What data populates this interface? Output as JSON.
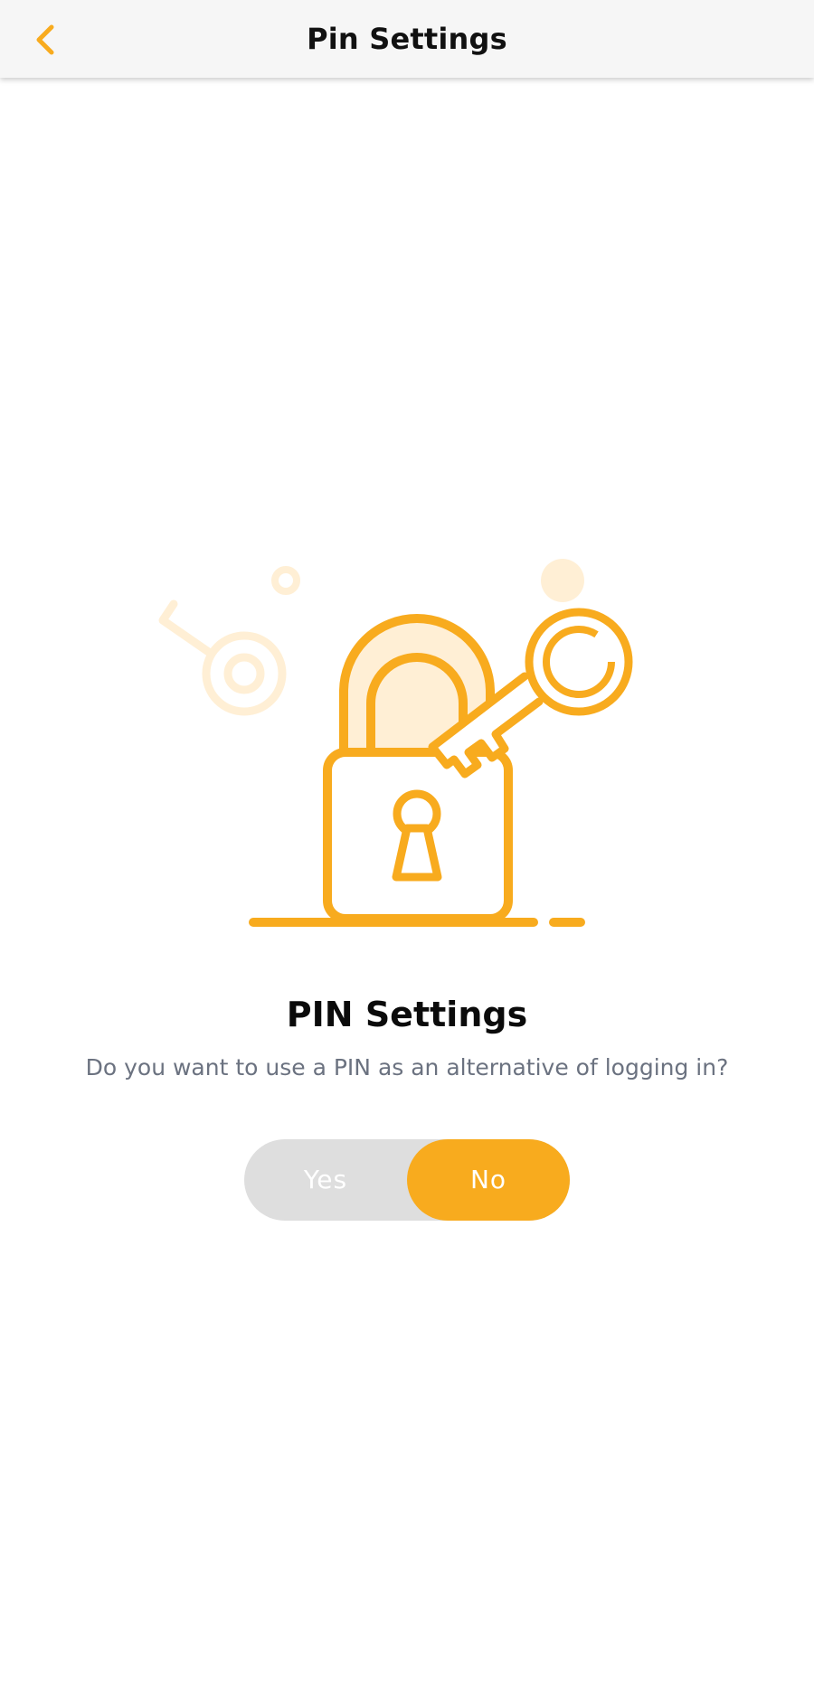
{
  "header": {
    "title": "Pin Settings"
  },
  "content": {
    "title": "PIN Settings",
    "subtitle": "Do you want to use a PIN as an alternative of logging in?"
  },
  "toggle": {
    "options": [
      {
        "label": "Yes",
        "selected": false
      },
      {
        "label": "No",
        "selected": true
      }
    ]
  },
  "colors": {
    "accent": "#F8AB1E",
    "toggle_track": "#DEDEDE",
    "illustration_light": "#FFEFD5"
  },
  "icons": {
    "back": "chevron-left-icon",
    "illustration": "padlock-with-key-icon"
  }
}
